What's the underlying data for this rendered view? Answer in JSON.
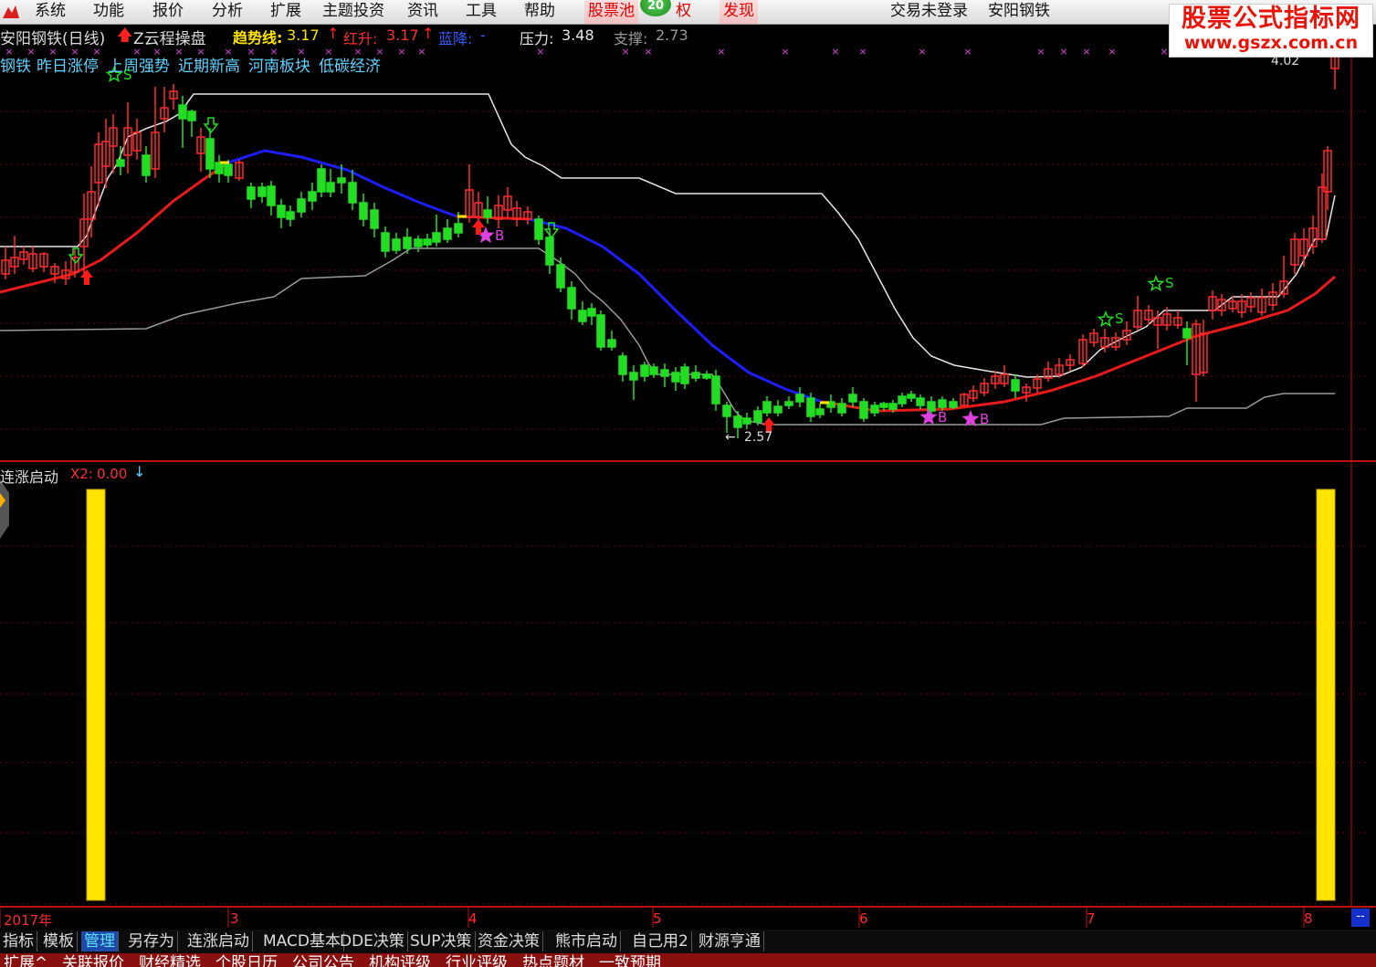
{
  "menu": {
    "items": [
      "系统",
      "功能",
      "报价",
      "分析",
      "扩展",
      "主题投资",
      "资讯",
      "工具",
      "帮助"
    ],
    "stock_pool": "股票池",
    "badge": "20",
    "rights_suffix": "权",
    "discover": "发现",
    "trade_status": "交易未登录",
    "stock_name": "安阳钢铁"
  },
  "watermark": {
    "line1": "股票公式指标网",
    "line2": "www.gszx.com.cn"
  },
  "colors": {
    "up": "#ff2b2b",
    "down": "#22dd22",
    "trend": "#e81a1a",
    "trend_down": "#1d1dff",
    "channel": "#e6e6e6",
    "bar": "#ffe400"
  },
  "indicator_top": {
    "title": "安阳钢铁(日线)",
    "formula": "Z云程操盘",
    "trend_label": "趋势线:",
    "trend_value": "3.17",
    "red_label": "红升:",
    "red_value": "3.17",
    "blue_label": "蓝降:",
    "blue_value": "-",
    "pressure_label": "压力:",
    "pressure_value": "3.48",
    "support_label": "支撑:",
    "support_value": "2.73"
  },
  "concepts": [
    "钢铁",
    "昨日涨停",
    "上周强势",
    "近期新高",
    "河南板块",
    "低碳经济"
  ],
  "price_labels": {
    "high": "4.02",
    "low": "2.57"
  },
  "signal_labels": {
    "buy": "B",
    "sell": "S"
  },
  "indicator_bottom": {
    "title": "连涨启动",
    "x2_label": "X2:",
    "x2_value": "0.00"
  },
  "timeline": {
    "labels": [
      "2017年",
      "3",
      "4",
      "5",
      "6",
      "7",
      "8"
    ],
    "end_marker": "--"
  },
  "bottom_tabs": [
    "指标",
    "模板",
    "管理",
    "另存为",
    "连涨启动",
    "MACD基本",
    "DDE决策",
    "SUP决策",
    "资金决策",
    "熊市启动",
    "自己用2",
    "财源亨通"
  ],
  "bottom_row2": [
    "扩展^",
    "关联报价",
    "财经精选",
    "个股日历",
    "公司公告",
    "机构评级",
    "行业评级",
    "热点题材",
    "一致预期"
  ],
  "chart_data": {
    "type": "candlestick",
    "ylim": [
      2.4,
      4.1
    ],
    "price_low": 2.57,
    "price_high": 4.02,
    "trend_value": 3.17,
    "pressure": 3.48,
    "support": 2.73,
    "sub_indicator": {
      "name": "连涨启动",
      "bars": [
        1,
        1
      ],
      "positions": [
        "start",
        "end"
      ]
    }
  }
}
